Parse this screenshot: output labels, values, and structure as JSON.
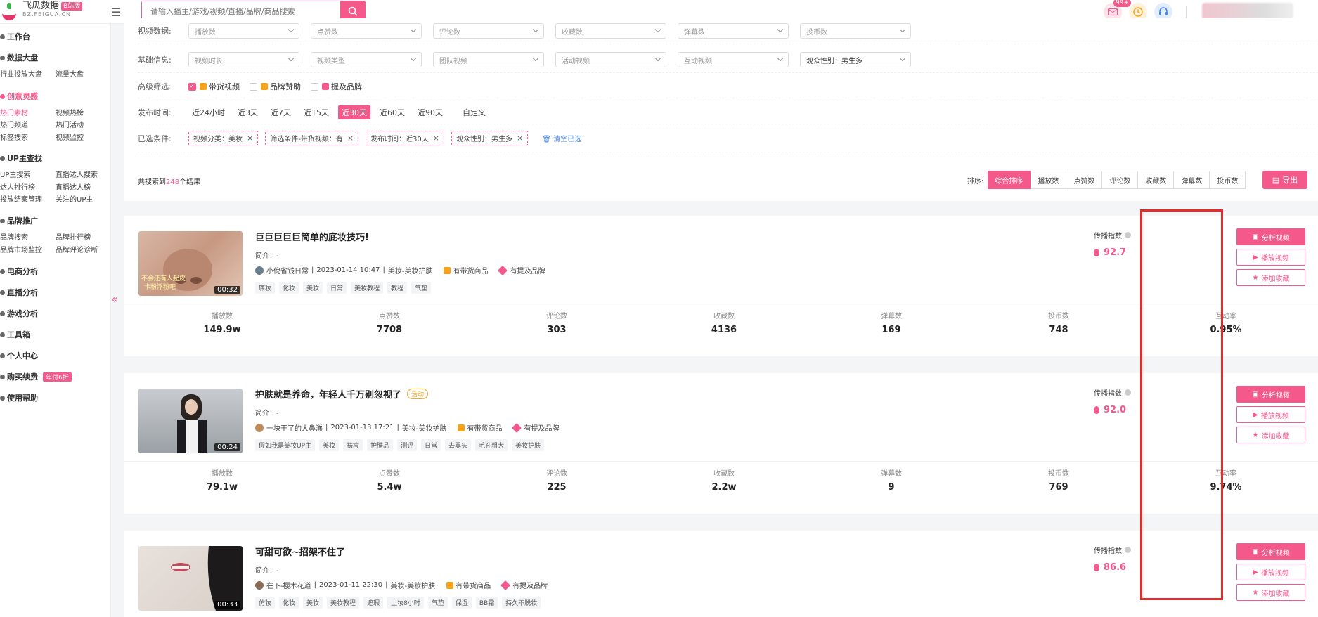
{
  "app": {
    "name": "飞瓜数据",
    "badge": "B站版",
    "domain": "BZ.FEIGUA.CN"
  },
  "search": {
    "placeholder": "请输入播主/游戏/视频/直播/品牌/商品搜索"
  },
  "topbar": {
    "notif_count": "99+"
  },
  "sidebar": {
    "groups": [
      {
        "label": "工作台"
      },
      {
        "label": "数据大盘",
        "subs": [
          "行业投放大盘",
          "流量大盘"
        ]
      },
      {
        "label": "创意灵感",
        "subs": [
          "热门素材",
          "视频热榜",
          "热门频道",
          "热门活动",
          "标签搜索",
          "视频监控"
        ]
      },
      {
        "label": "UP主查找",
        "subs": [
          "UP主搜索",
          "直播达人搜索",
          "达人排行榜",
          "直播达人榜",
          "投放结案管理",
          "关注的UP主"
        ]
      },
      {
        "label": "品牌推广",
        "subs": [
          "品牌搜索",
          "品牌排行榜",
          "品牌市场监控",
          "品牌评论诊断"
        ]
      },
      {
        "label": "电商分析"
      },
      {
        "label": "直播分析"
      },
      {
        "label": "游戏分析"
      },
      {
        "label": "工具箱"
      },
      {
        "label": "个人中心"
      },
      {
        "label": "购买续费",
        "promo": "年付6折"
      },
      {
        "label": "使用帮助"
      }
    ]
  },
  "filters": {
    "video_data_label": "视频数据:",
    "video_data": [
      "播放数",
      "点赞数",
      "评论数",
      "收藏数",
      "弹幕数",
      "投币数"
    ],
    "basic_label": "基础信息:",
    "basic": [
      "视频时长",
      "视频类型",
      "团队视频",
      "活动视频",
      "互动视频",
      "观众性别：男生多"
    ],
    "advanced_label": "高级筛选:",
    "advanced": [
      {
        "label": "带货视频",
        "checked": true
      },
      {
        "label": "品牌赞助",
        "checked": false
      },
      {
        "label": "提及品牌",
        "checked": false
      }
    ],
    "time_label": "发布时间:",
    "times": [
      "近24小时",
      "近3天",
      "近7天",
      "近15天",
      "近30天",
      "近60天",
      "近90天",
      "自定义"
    ],
    "time_active": 4,
    "selected_label": "已选条件:",
    "selected": [
      "视频分类：美妆",
      "筛选条件-带货视频：有",
      "发布时间：近30天",
      "观众性别：男生多"
    ],
    "clear": "清空已选"
  },
  "results": {
    "prefix": "共搜索到",
    "count": "248",
    "suffix": "个结果"
  },
  "sort": {
    "label": "排序:",
    "options": [
      "综合排序",
      "播放数",
      "点赞数",
      "评论数",
      "收藏数",
      "弹幕数",
      "投币数"
    ],
    "active": 0,
    "export": "导出"
  },
  "stat_labels": [
    "播放数",
    "点赞数",
    "评论数",
    "收藏数",
    "弹幕数",
    "投币数",
    "互动率"
  ],
  "actions": {
    "analyze": "分析视频",
    "play": "播放视频",
    "favorite": "添加收藏"
  },
  "spread_label": "传播指数",
  "videos": [
    {
      "title": "巨巨巨巨巨简单的底妆技巧!",
      "activity": "",
      "intro": "简介：-",
      "author": "小倪省钱日常",
      "date": "2023-01-14 10:47",
      "category": "美妆-美妆护肤",
      "goods": "有带货商品",
      "brand": "有提及品牌",
      "duration": "00:32",
      "tags": [
        "底妆",
        "化妆",
        "美妆",
        "日常",
        "美妆教程",
        "教程",
        "气垫"
      ],
      "spread": "92.7",
      "stats": [
        "149.9w",
        "7708",
        "303",
        "4136",
        "169",
        "748",
        "0.95%"
      ],
      "thumb_text": "不会还有人起皮\n卡粉浮粉吧"
    },
    {
      "title": "护肤就是养命，年轻人千万别忽视了",
      "activity": "活动",
      "intro": "简介：-",
      "author": "一块干了的大鼻涕",
      "date": "2023-01-13 17:21",
      "category": "美妆-美妆护肤",
      "goods": "有带货商品",
      "brand": "有提及品牌",
      "duration": "00:24",
      "tags": [
        "假如我是美妆UP主",
        "美妆",
        "祛痘",
        "护肤品",
        "测评",
        "日常",
        "去黑头",
        "毛孔粗大",
        "美妆护肤"
      ],
      "spread": "92.0",
      "stats": [
        "79.1w",
        "5.4w",
        "225",
        "2.2w",
        "9",
        "769",
        "9.74%"
      ],
      "thumb_text": ""
    },
    {
      "title": "可甜可欲~招架不住了",
      "activity": "",
      "intro": "简介：-",
      "author": "在下-樱木花道",
      "date": "2023-01-11 22:30",
      "category": "美妆-美妆护肤",
      "goods": "有带货商品",
      "brand": "有提及品牌",
      "duration": "00:33",
      "tags": [
        "仿妆",
        "化妆",
        "美妆",
        "美妆教程",
        "遮瑕",
        "上妆8小时",
        "气垫",
        "保湿",
        "BB霜",
        "持久不脱妆"
      ],
      "spread": "86.6",
      "stats": [
        "",
        "",
        "",
        "",
        "",
        "",
        ""
      ],
      "thumb_text": ""
    }
  ],
  "colors": {
    "accent": "#f5588a",
    "highlight_box": "#e62b2b"
  }
}
